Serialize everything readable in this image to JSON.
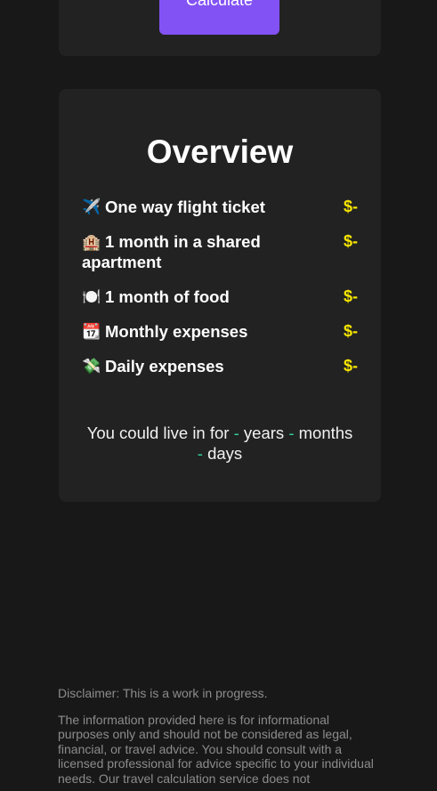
{
  "calculator": {
    "button_label": "Calculate"
  },
  "overview": {
    "title": "Overview",
    "items": [
      {
        "icon": "airplane-icon",
        "glyph": "✈️",
        "label": "One way flight ticket",
        "value": "$-"
      },
      {
        "icon": "hotel-icon",
        "glyph": "🏨",
        "label": "1 month in a shared apartment",
        "value": "$-"
      },
      {
        "icon": "plate-icon",
        "glyph": "🍽️",
        "label": "1 month of food",
        "value": "$-"
      },
      {
        "icon": "calendar-icon",
        "glyph": "📆",
        "label": "Monthly expenses",
        "value": "$-"
      },
      {
        "icon": "money-icon",
        "glyph": "💸",
        "label": "Daily expenses",
        "value": "$-"
      }
    ],
    "live_for": {
      "prefix": "You could live in for",
      "years_value": "-",
      "years_label": "years",
      "months_value": "-",
      "months_label": "months",
      "days_value": "-",
      "days_label": "days"
    }
  },
  "footer": {
    "disclaimer": "Disclaimer: This is a work in progress.",
    "info": "The information provided here is for informational purposes only and should not be considered as legal, financial, or travel advice. You should consult with a licensed professional for advice specific to your individual needs. Our travel calculation service does not"
  },
  "colors": {
    "background": "#181818",
    "card": "#222222",
    "accent_button": "#8352f5",
    "value_yellow": "#f7e600",
    "dash_green": "#2fd39a"
  }
}
